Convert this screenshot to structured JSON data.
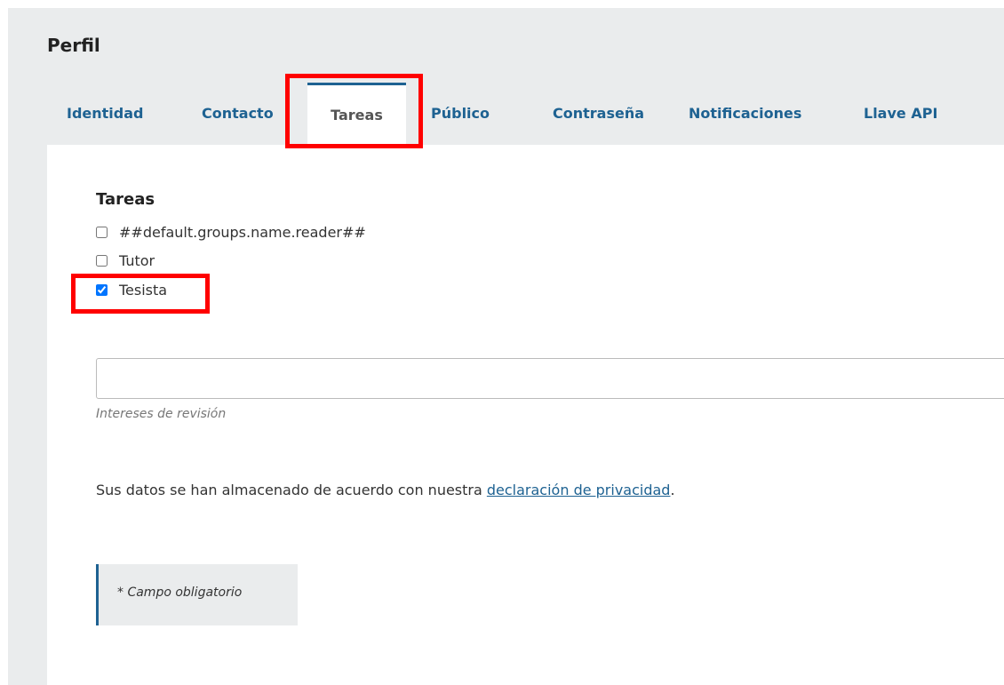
{
  "page": {
    "title": "Perfil"
  },
  "tabs": [
    {
      "label": "Identidad",
      "active": false
    },
    {
      "label": "Contacto",
      "active": false
    },
    {
      "label": "Tareas",
      "active": true
    },
    {
      "label": "Público",
      "active": false
    },
    {
      "label": "Contraseña",
      "active": false
    },
    {
      "label": "Notificaciones",
      "active": false
    },
    {
      "label": "Llave API",
      "active": false
    }
  ],
  "roles": {
    "heading": "Tareas",
    "options": [
      {
        "label": "##default.groups.name.reader##",
        "checked": false
      },
      {
        "label": "Tutor",
        "checked": false
      },
      {
        "label": "Tesista",
        "checked": true
      }
    ]
  },
  "review_interests": {
    "value": "",
    "description": "Intereses de revisión"
  },
  "privacy": {
    "text_before": "Sus datos se han almacenado de acuerdo con nuestra ",
    "link_text": "declaración de privacidad",
    "text_after": "."
  },
  "required_note": "* Campo obligatorio",
  "colors": {
    "accent": "#1e6292",
    "page_background": "#eaeced",
    "annotation": "#ff0000"
  }
}
